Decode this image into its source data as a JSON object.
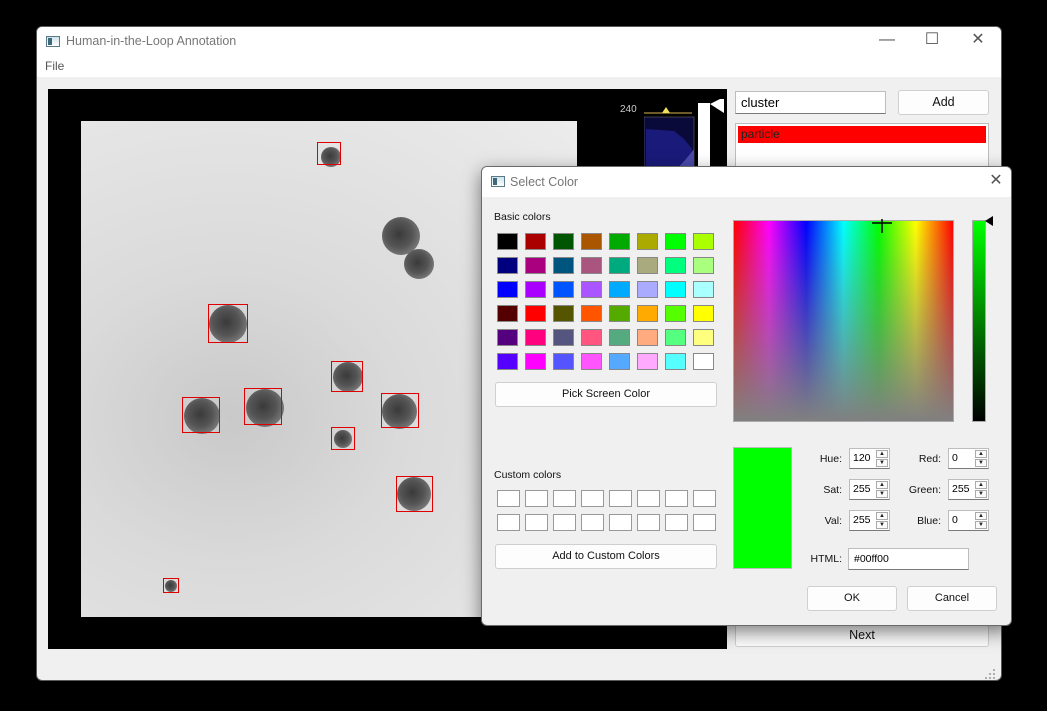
{
  "app": {
    "title": "Human-in-the-Loop Annotation",
    "menu": [
      "File"
    ]
  },
  "window_controls": {
    "minimize": "—",
    "maximize": "☐",
    "close": "✕"
  },
  "histogram": {
    "max_label": "240"
  },
  "label_panel": {
    "input_value": "cluster",
    "add_label": "Add",
    "labels": [
      "particle"
    ],
    "selected_label": "particle",
    "selected_color": "#ff0000",
    "next_label": "Next"
  },
  "dialog": {
    "title": "Select Color",
    "basic_colors_label": "Basic colors",
    "basic_colors": [
      [
        "#000000",
        "#aa0000",
        "#005500",
        "#aa5500",
        "#00aa00",
        "#aaaa00",
        "#00ff00",
        "#aaff00"
      ],
      [
        "#00007f",
        "#aa007f",
        "#00557f",
        "#aa557f",
        "#00aa7f",
        "#aaaa7f",
        "#00ff7f",
        "#aaff7f"
      ],
      [
        "#0000ff",
        "#aa00ff",
        "#0055ff",
        "#aa55ff",
        "#00aaff",
        "#aaaaff",
        "#00ffff",
        "#aaffff"
      ],
      [
        "#550000",
        "#ff0000",
        "#555500",
        "#ff5500",
        "#55aa00",
        "#ffaa00",
        "#55ff00",
        "#ffff00"
      ],
      [
        "#55007f",
        "#ff007f",
        "#55557f",
        "#ff557f",
        "#55aa7f",
        "#ffaa7f",
        "#55ff7f",
        "#ffff7f"
      ],
      [
        "#5500ff",
        "#ff00ff",
        "#5555ff",
        "#ff55ff",
        "#55aaff",
        "#ffaaff",
        "#55ffff",
        "#ffffff"
      ]
    ],
    "pick_screen_label": "Pick Screen Color",
    "custom_colors_label": "Custom colors",
    "add_custom_label": "Add to Custom Colors",
    "current_color": "#00ff00",
    "hue_label": "Hue:",
    "hue": "120",
    "sat_label": "Sat:",
    "sat": "255",
    "val_label": "Val:",
    "val": "255",
    "red_label": "Red:",
    "red": "0",
    "green_label": "Green:",
    "green": "255",
    "blue_label": "Blue:",
    "blue": "0",
    "html_label": "HTML:",
    "html": "#00ff00",
    "ok_label": "OK",
    "cancel_label": "Cancel"
  }
}
